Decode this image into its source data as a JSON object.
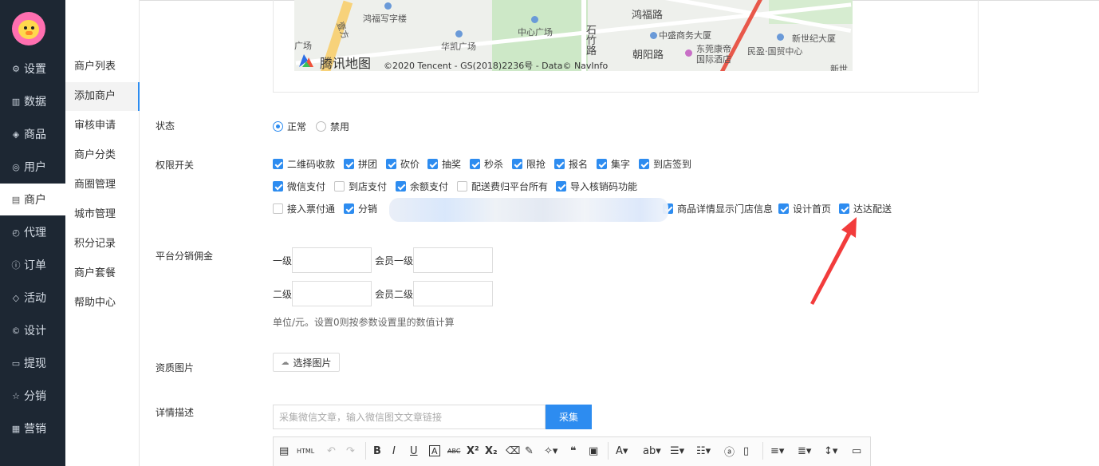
{
  "sidebar": {
    "items": [
      {
        "label": "设置",
        "icon": "gear-icon",
        "glyph": "⚙"
      },
      {
        "label": "数据",
        "icon": "bar-chart-icon",
        "glyph": "▥"
      },
      {
        "label": "商品",
        "icon": "box-icon",
        "glyph": "◈"
      },
      {
        "label": "用户",
        "icon": "user-icon",
        "glyph": "◎"
      },
      {
        "label": "商户",
        "icon": "document-icon",
        "glyph": "▤"
      },
      {
        "label": "代理",
        "icon": "clock-icon",
        "glyph": "◴"
      },
      {
        "label": "订单",
        "icon": "info-icon",
        "glyph": "ⓘ"
      },
      {
        "label": "活动",
        "icon": "tag-icon",
        "glyph": "◇"
      },
      {
        "label": "设计",
        "icon": "copyright-icon",
        "glyph": "©"
      },
      {
        "label": "提现",
        "icon": "card-icon",
        "glyph": "▭"
      },
      {
        "label": "分销",
        "icon": "star-icon",
        "glyph": "☆"
      },
      {
        "label": "营销",
        "icon": "grid-icon",
        "glyph": "▦"
      }
    ],
    "active_index": 4
  },
  "subnav": {
    "items": [
      "商户列表",
      "添加商户",
      "审核申请",
      "商户分类",
      "商圈管理",
      "城市管理",
      "积分记录",
      "商户套餐",
      "帮助中心"
    ],
    "active_index": 1
  },
  "map": {
    "brand": "腾讯地图",
    "copyright": "©2020 Tencent - GS(2018)2236号 - Data© NavInfo",
    "labels": [
      "鸿福写字楼",
      "鸿福路",
      "中心广场",
      "中盛商务大厦",
      "新世纪大厦",
      "华凯广场",
      "石竹路",
      "朝阳路",
      "东莞康帝",
      "国际酒店",
      "民盈·国贸中心",
      "广场",
      "新世",
      "壹方"
    ]
  },
  "form": {
    "status": {
      "label": "状态",
      "options": [
        "正常",
        "禁用"
      ],
      "selected": "正常"
    },
    "permissions": {
      "label": "权限开关",
      "rows": [
        [
          {
            "text": "二维码收款",
            "checked": true
          },
          {
            "text": "拼团",
            "checked": true
          },
          {
            "text": "砍价",
            "checked": true
          },
          {
            "text": "抽奖",
            "checked": true
          },
          {
            "text": "秒杀",
            "checked": true
          },
          {
            "text": "限抢",
            "checked": true
          },
          {
            "text": "报名",
            "checked": true
          },
          {
            "text": "集字",
            "checked": true
          },
          {
            "text": "到店签到",
            "checked": true
          }
        ],
        [
          {
            "text": "微信支付",
            "checked": true
          },
          {
            "text": "到店支付",
            "checked": false
          },
          {
            "text": "余额支付",
            "checked": true
          },
          {
            "text": "配送费归平台所有",
            "checked": false
          },
          {
            "text": "导入核销码功能",
            "checked": true
          }
        ],
        [
          {
            "text": "接入票付通",
            "checked": false
          },
          {
            "text": "分销",
            "checked": true
          },
          {
            "text": "商品详情显示门店信息",
            "checked": true
          },
          {
            "text": "设计首页",
            "checked": true
          },
          {
            "text": "达达配送",
            "checked": true
          }
        ]
      ]
    },
    "commission": {
      "label": "平台分销佣金",
      "level1": "一级",
      "member_level1": "会员一级",
      "level2": "二级",
      "member_level2": "会员二级",
      "hint": "单位/元。设置0则按参数设置里的数值计算"
    },
    "qualification": {
      "label": "资质图片",
      "button": "选择图片",
      "icon": "cloud-upload-icon"
    },
    "description": {
      "label": "详情描述",
      "placeholder": "采集微信文章，输入微信图文文章链接",
      "collect_button": "采集"
    }
  },
  "editor_toolbar": {
    "html_label": "HTML",
    "buttons": [
      "B",
      "I",
      "U",
      "A",
      "ABC",
      "X²",
      "X₂",
      "❝"
    ]
  }
}
